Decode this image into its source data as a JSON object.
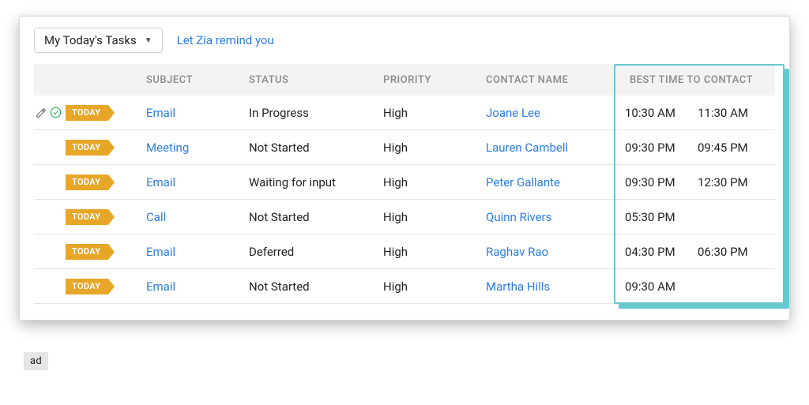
{
  "topbar": {
    "dropdown_label": "My Today's Tasks",
    "zia_link": "Let Zia remind you"
  },
  "columns": {
    "subject": "SUBJECT",
    "status": "STATUS",
    "priority": "PRIORITY",
    "contact": "CONTACT NAME",
    "best_time": "BEST TIME TO CONTACT"
  },
  "badge_text": "TODAY",
  "rows": [
    {
      "subject": "Email",
      "status": "In Progress",
      "priority": "High",
      "contact": "Joane Lee",
      "time1": "10:30 AM",
      "time2": "11:30 AM"
    },
    {
      "subject": "Meeting",
      "status": "Not Started",
      "priority": "High",
      "contact": "Lauren Cambell",
      "time1": "09:30 PM",
      "time2": "09:45 PM"
    },
    {
      "subject": "Email",
      "status": "Waiting for input",
      "priority": "High",
      "contact": "Peter Gallante",
      "time1": "09:30 PM",
      "time2": "12:30 PM"
    },
    {
      "subject": "Call",
      "status": "Not Started",
      "priority": "High",
      "contact": "Quinn Rivers",
      "time1": "05:30 PM",
      "time2": ""
    },
    {
      "subject": "Email",
      "status": "Deferred",
      "priority": "High",
      "contact": "Raghav Rao",
      "time1": "04:30 PM",
      "time2": "06:30 PM"
    },
    {
      "subject": "Email",
      "status": "Not Started",
      "priority": "High",
      "contact": "Martha Hills",
      "time1": "09:30 AM",
      "time2": ""
    }
  ],
  "footer_box": "ad"
}
